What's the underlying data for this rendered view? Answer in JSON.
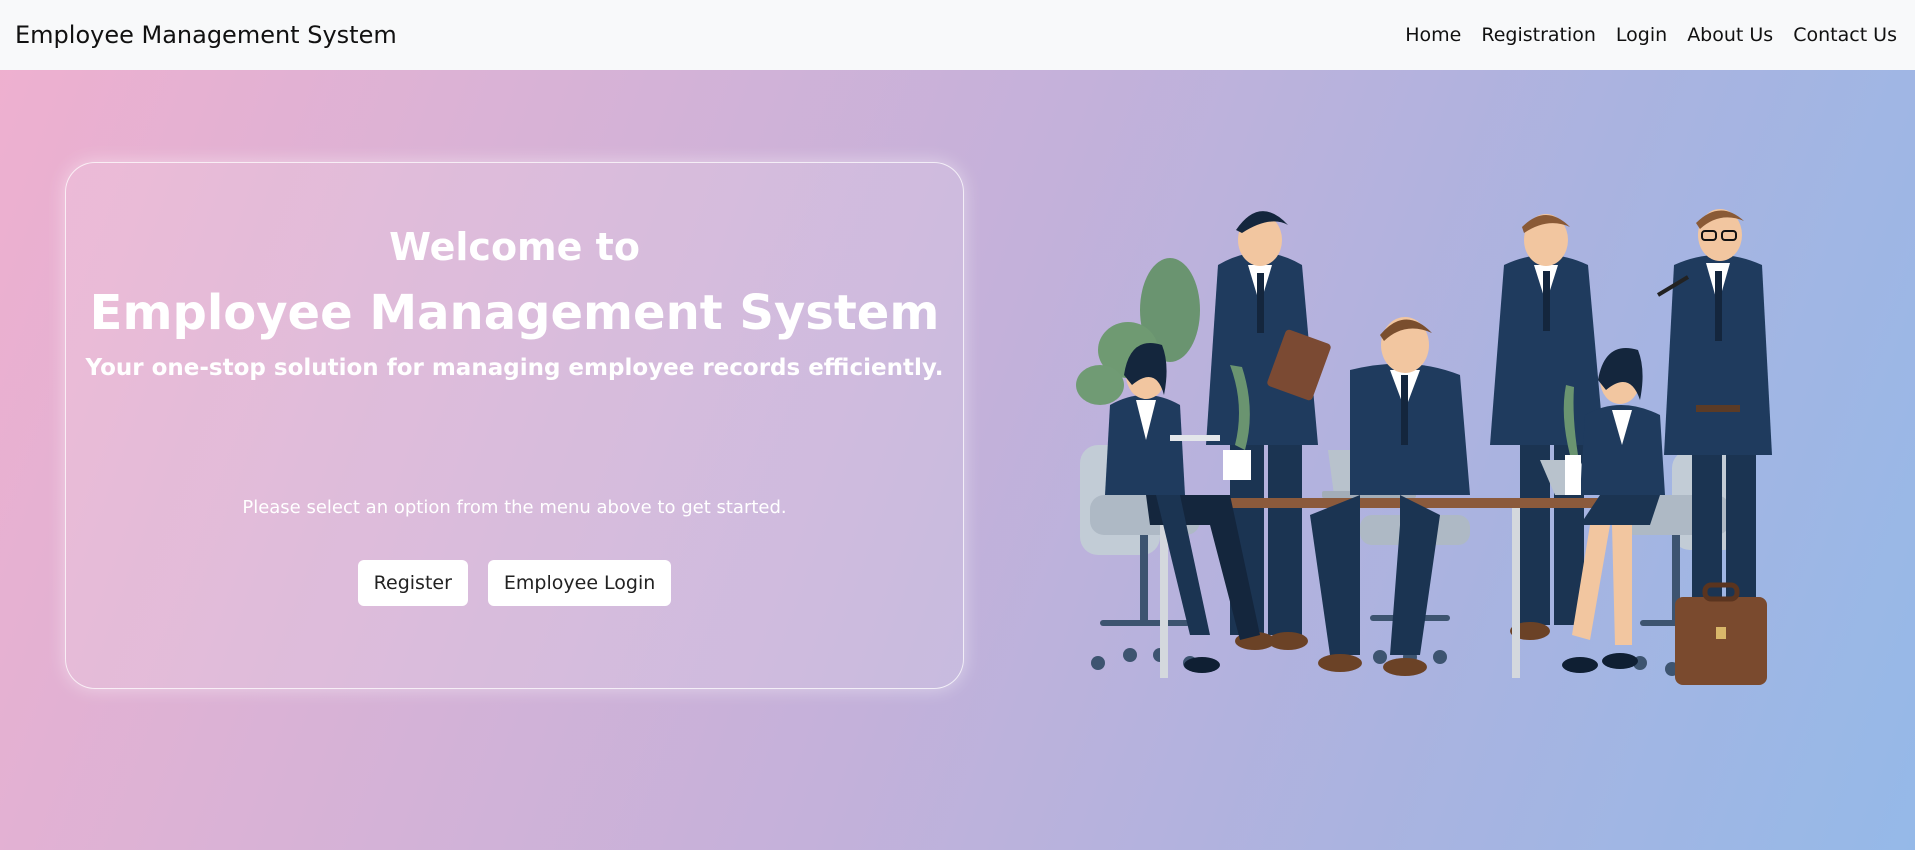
{
  "navbar": {
    "brand": "Employee Management System",
    "links": [
      "Home",
      "Registration",
      "Login",
      "About Us",
      "Contact Us"
    ]
  },
  "hero": {
    "welcome": "Welcome to",
    "title": "Employee Management System",
    "subtitle": "Your one-stop solution for managing employee records efficiently.",
    "prompt": "Please select an option from the menu above to get started.",
    "register_label": "Register",
    "login_label": "Employee Login"
  },
  "colors": {
    "navbar_bg": "#f8f9fa",
    "gradient_start": "#efb0cf",
    "gradient_end": "#95b9e8",
    "suit": "#1f3b5e",
    "button_bg": "#ffffff"
  },
  "illustration": {
    "icon": "office-team-illustration"
  }
}
